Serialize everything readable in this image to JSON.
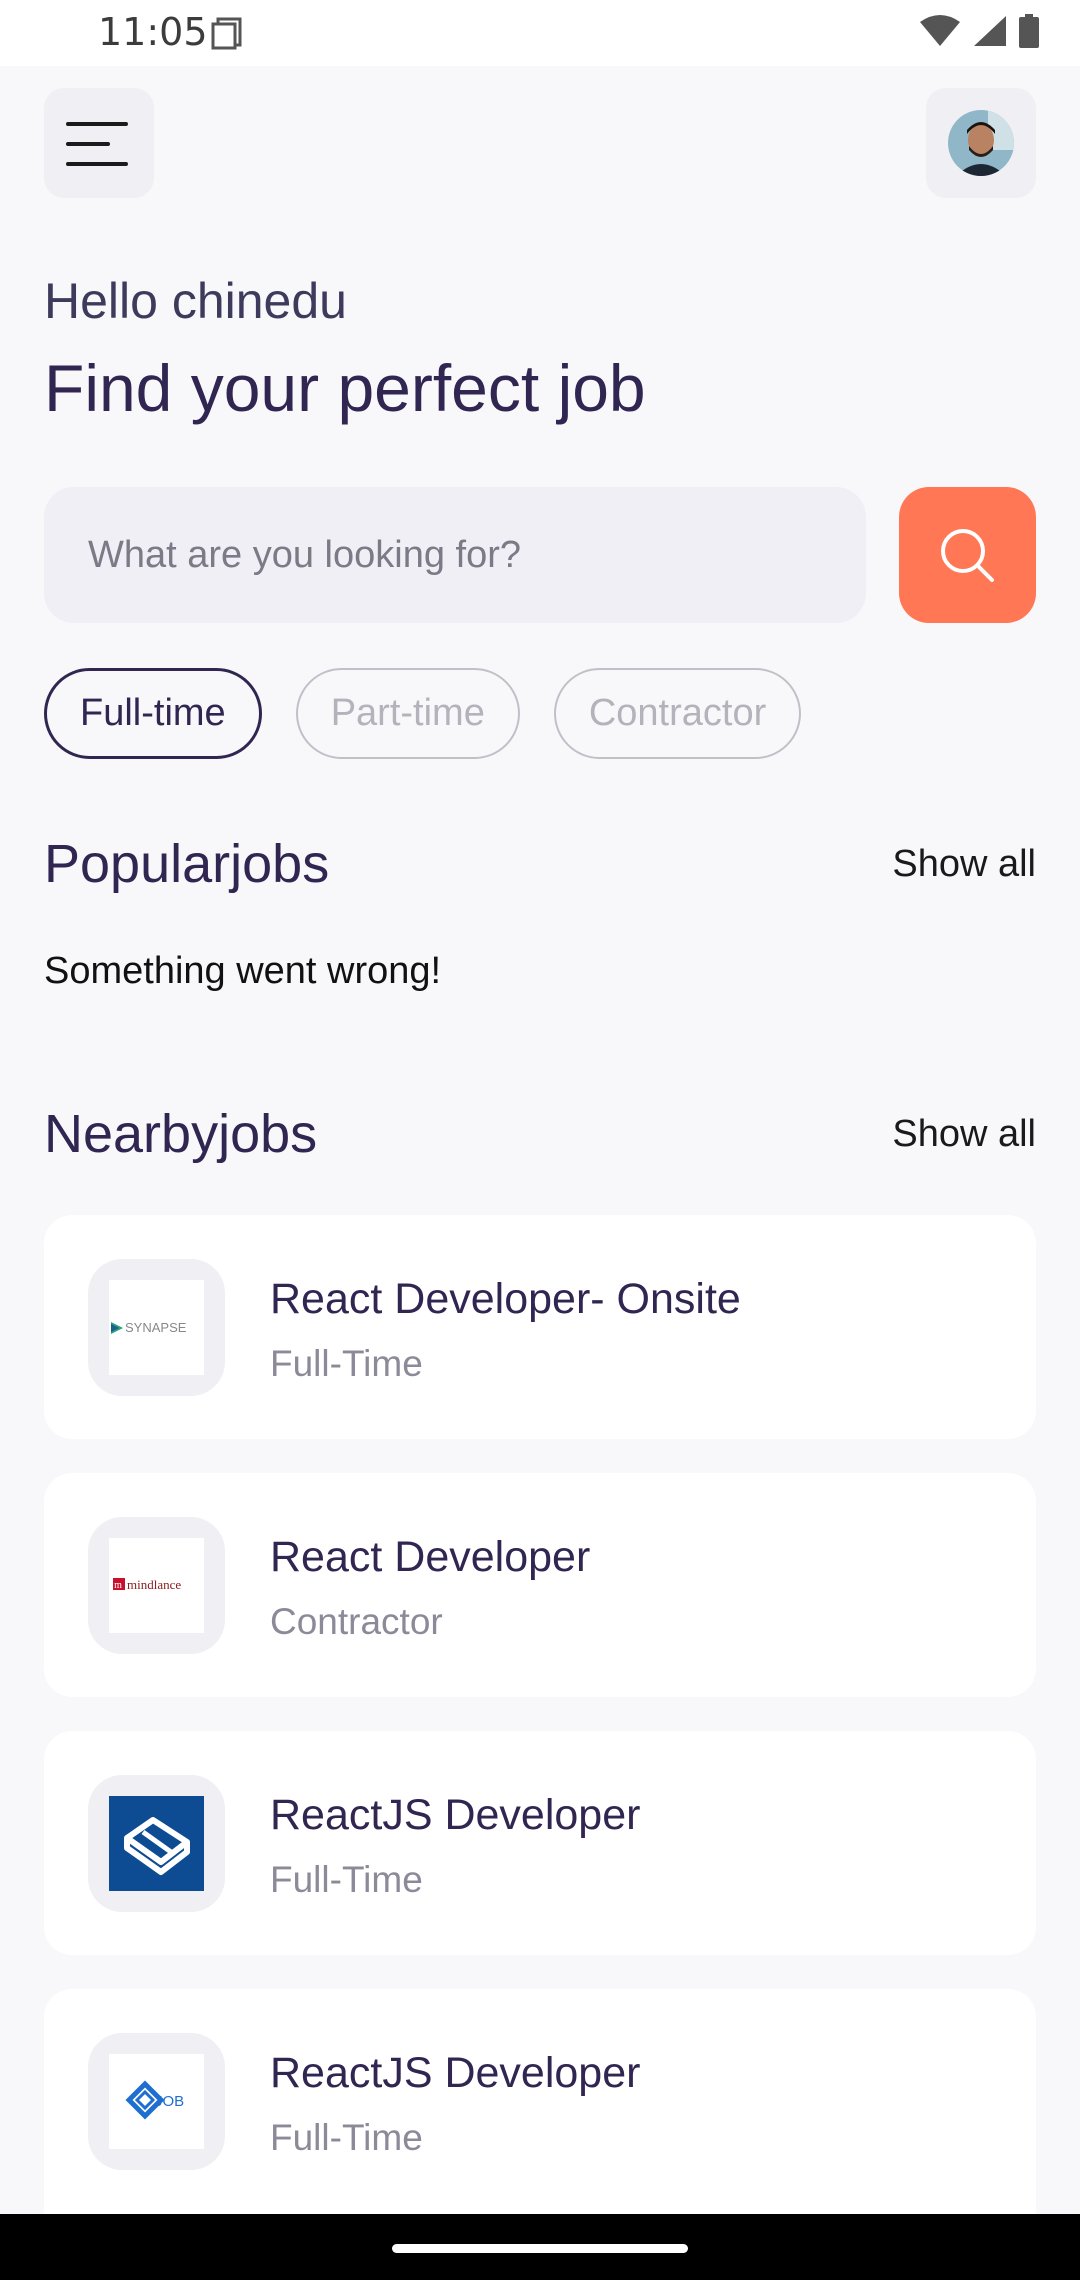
{
  "status_bar": {
    "time": "11:05",
    "icons": [
      "sd-card-icon",
      "wifi-icon",
      "signal-icon",
      "battery-icon"
    ]
  },
  "header": {
    "menu_icon": "menu-icon",
    "avatar_icon": "profile-avatar"
  },
  "welcome": {
    "greeting": "Hello chinedu",
    "headline": "Find your perfect job"
  },
  "search": {
    "placeholder": "What are you looking for?",
    "value": "",
    "button_icon": "search-icon"
  },
  "job_types": {
    "selected": "Full-time",
    "items": [
      {
        "label": "Full-time"
      },
      {
        "label": "Part-time"
      },
      {
        "label": "Contractor"
      }
    ]
  },
  "popular": {
    "title": "Popularjobs",
    "show_all": "Show all",
    "error": "Something went wrong!"
  },
  "nearby": {
    "title": "Nearbyjobs",
    "show_all": "Show all",
    "jobs": [
      {
        "title": "React Developer- Onsite",
        "type": "Full-Time",
        "logo_text": "SYNAPSE"
      },
      {
        "title": "React Developer",
        "type": "Contractor",
        "logo_text": "mindlance"
      },
      {
        "title": "ReactJS Developer",
        "type": "Full-Time",
        "logo_text": ""
      },
      {
        "title": "ReactJS Developer",
        "type": "Full-Time",
        "logo_text": "JOB"
      }
    ]
  },
  "colors": {
    "primary": "#312651",
    "accent": "#ff7754",
    "background": "#f8f8fb",
    "muted": "#8c8a98"
  }
}
